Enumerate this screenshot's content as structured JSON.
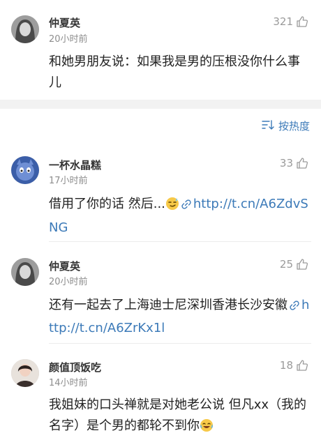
{
  "top_comment": {
    "name": "仲夏英",
    "time": "20小时前",
    "likes": "321",
    "text": "和她男朋友说：如果我是男的压根没你什么事儿"
  },
  "sort": {
    "label": "按热度",
    "icon": "sort-icon"
  },
  "comments": [
    {
      "name": "一杯水晶糕",
      "time": "17小时前",
      "likes": "33",
      "text": "借用了你的话 然后...",
      "emoji": "smirk-emoji",
      "link": "http://t.cn/A6ZdvSNG"
    },
    {
      "name": "仲夏英",
      "time": "20小时前",
      "likes": "25",
      "text": "还有一起去了上海迪士尼深圳香港长沙安徽",
      "link": "http://t.cn/A6ZrKx1l"
    },
    {
      "name": "颜值顶饭吃",
      "time": "14小时前",
      "likes": "18",
      "text": "我姐妹的口头禅就是对她老公说 但凡xx（我的名字）是个男的都轮不到你",
      "emoji": "laughing-tears-emoji"
    }
  ],
  "colors": {
    "link": "#3c7ab8",
    "time": "#8d8d8d",
    "like_count": "#9a9a9a",
    "divider": "#f2f2f2"
  }
}
